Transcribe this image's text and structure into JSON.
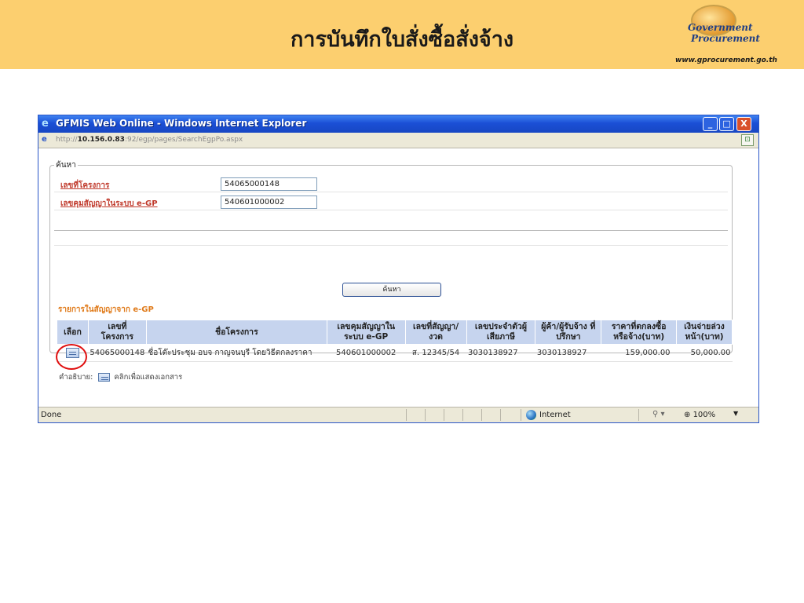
{
  "slide": {
    "title": "การบันทึกใบสั่งซื้อสั่งจ้าง",
    "logo": {
      "line1": "Government",
      "line2": "Procurement",
      "url": "www.gprocurement.go.th"
    }
  },
  "window": {
    "title": "GFMIS Web Online - Windows Internet Explorer",
    "minimize": "_",
    "maximize": "□",
    "close": "X",
    "address_prefix": "http://",
    "address_host": "10.156.0.83",
    "address_rest": ":92/egp/pages/SearchEgpPo.aspx"
  },
  "search": {
    "legend": "ค้นหา",
    "project_no_label": "เลขที่โครงการ",
    "project_no_value": "54065000148",
    "egp_contract_label": "เลขคุมสัญญาในระบบ e-GP",
    "egp_contract_value": "540601000002",
    "button_label": "ค้นหา"
  },
  "results": {
    "label": "รายการในสัญญาจาก e-GP",
    "headers": {
      "select": "เลือก",
      "project_no": "เลขที่ โครงการ",
      "project_name": "ชื่อโครงการ",
      "egp_contract": "เลขคุมสัญญาใน ระบบ e-GP",
      "contract_no": "เลขที่สัญญา/ งวด",
      "tax_id": "เลขประจำตัวผู้ เสียภาษี",
      "vendor": "ผู้ค้า/ผู้รับจ้าง ที่ปรึกษา",
      "price": "ราคาที่ตกลงซื้อ หรือจ้าง(บาท)",
      "advance": "เงินจ่ายล่วง หน้า(บาท)"
    },
    "rows": [
      {
        "project_no": "54065000148",
        "project_name": "ชื่อโต๊ะประชุม อบจ กาญจนบุรี โดยวิธีตกลงราคา",
        "egp_contract": "540601000002",
        "contract_no": "ส. 12345/54",
        "tax_id": "3030138927",
        "vendor": "3030138927",
        "price": "159,000.00",
        "advance": "50,000.00"
      }
    ],
    "note_prefix": "คำอธิบาย:",
    "note_text": "คลิกเพื่อแสดงเอกสาร"
  },
  "statusbar": {
    "status": "Done",
    "zone": "Internet",
    "zoom": "100%"
  },
  "icons": {
    "select_document": "document-icon",
    "ie": "ie-icon",
    "zone": "globe-icon"
  }
}
